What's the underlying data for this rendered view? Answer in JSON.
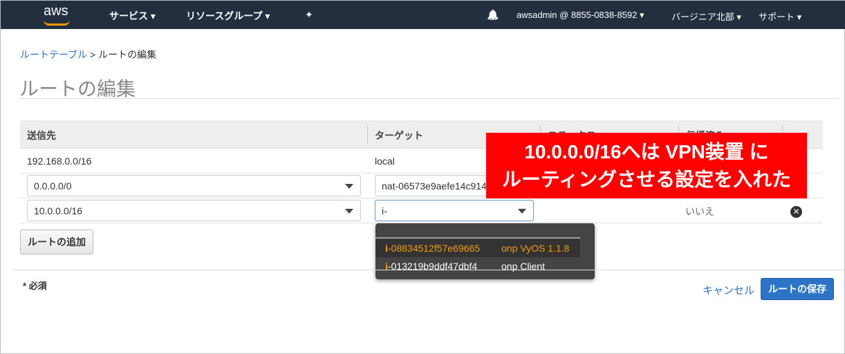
{
  "nav": {
    "logo": "aws",
    "services": "サービス ▾",
    "resource_groups": "リソースグループ ▾",
    "pin": "✦",
    "bell": "🔔",
    "account": "awsadmin @ 8855-0838-8592 ▾",
    "region": "バージニア北部 ▾",
    "support": "サポート ▾"
  },
  "breadcrumb": {
    "parent": "ルートテーブル",
    "sep": " > ",
    "current": "ルートの編集"
  },
  "title": "ルートの編集",
  "table": {
    "headers": [
      "送信先",
      "ターゲット",
      "ステータス",
      "伝播済み"
    ],
    "rows": [
      {
        "destination": "192.168.0.0/16",
        "target": "local"
      },
      {
        "destination": "0.0.0.0/0",
        "target": "nat-06573e9aefe14c914"
      },
      {
        "destination": "10.0.0.0/16",
        "target": "i-",
        "propagated": "いいえ"
      }
    ]
  },
  "add_route": "ルートの追加",
  "dropdown": {
    "options": [
      {
        "prefix": "i",
        "id": "-08834512f57e69665",
        "name": "onp VyOS 1.1.8"
      },
      {
        "prefix": "i",
        "id": "-013219b9ddf47dbf4",
        "name": "onp Client"
      }
    ]
  },
  "required": "* 必須",
  "cancel": "キャンセル",
  "save": "ルートの保存",
  "annotation": {
    "line1": "10.0.0.0/16へは VPN装置 に",
    "line2": "ルーティングさせる設定を入れた"
  },
  "colors": {
    "nav": "#232f3e",
    "accent": "#f39c12",
    "primary": "#2e74c6",
    "annotation": "#ff0000"
  }
}
